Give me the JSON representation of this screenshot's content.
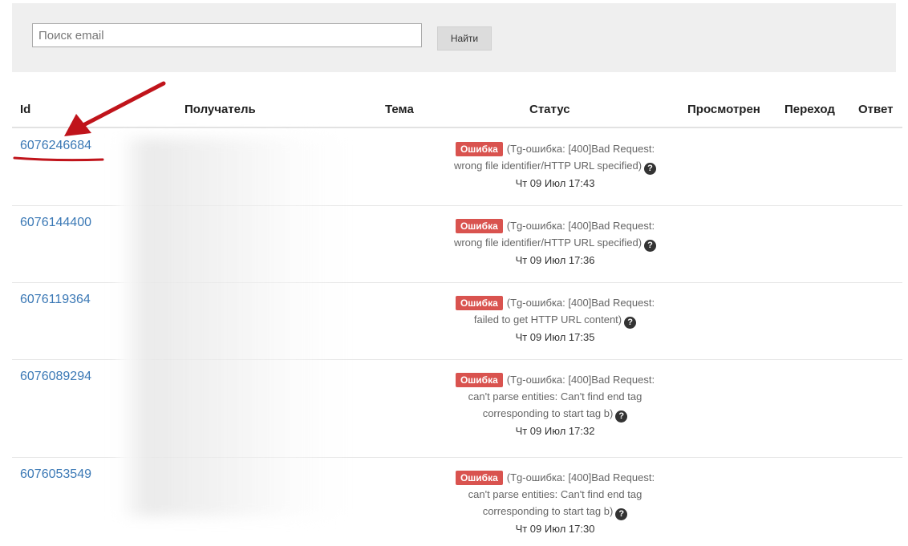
{
  "search": {
    "placeholder": "Поиск email",
    "value": "",
    "button_label": "Найти"
  },
  "table": {
    "columns": [
      "Id",
      "Получатель",
      "Тема",
      "Статус",
      "Просмотрен",
      "Переход",
      "Ответ"
    ],
    "rows": [
      {
        "id": "6076246684",
        "badge": "Ошибка",
        "status_lines": [
          "(Tg-ошибка: [400]Bad Request:",
          "wrong file identifier/HTTP URL specified)"
        ],
        "time": "Чт 09 Июл 17:43"
      },
      {
        "id": "6076144400",
        "badge": "Ошибка",
        "status_lines": [
          "(Tg-ошибка: [400]Bad Request:",
          "wrong file identifier/HTTP URL specified)"
        ],
        "time": "Чт 09 Июл 17:36"
      },
      {
        "id": "6076119364",
        "badge": "Ошибка",
        "status_lines": [
          "(Tg-ошибка: [400]Bad Request:",
          "failed to get HTTP URL content)"
        ],
        "time": "Чт 09 Июл 17:35"
      },
      {
        "id": "6076089294",
        "badge": "Ошибка",
        "status_lines": [
          "(Tg-ошибка: [400]Bad Request:",
          "can't parse entities: Can't find end tag",
          "corresponding to start tag b)"
        ],
        "time": "Чт 09 Июл 17:32"
      },
      {
        "id": "6076053549",
        "badge": "Ошибка",
        "status_lines": [
          "(Tg-ошибка: [400]Bad Request:",
          "can't parse entities: Can't find end tag",
          "corresponding to start tag b)"
        ],
        "time": "Чт 09 Июл 17:30"
      }
    ]
  },
  "colors": {
    "link": "#3a78b5",
    "error_badge": "#d9534f",
    "annotation": "#c0141b"
  },
  "icons": {
    "help": "question-circle-icon",
    "annotation": "arrow-icon"
  }
}
